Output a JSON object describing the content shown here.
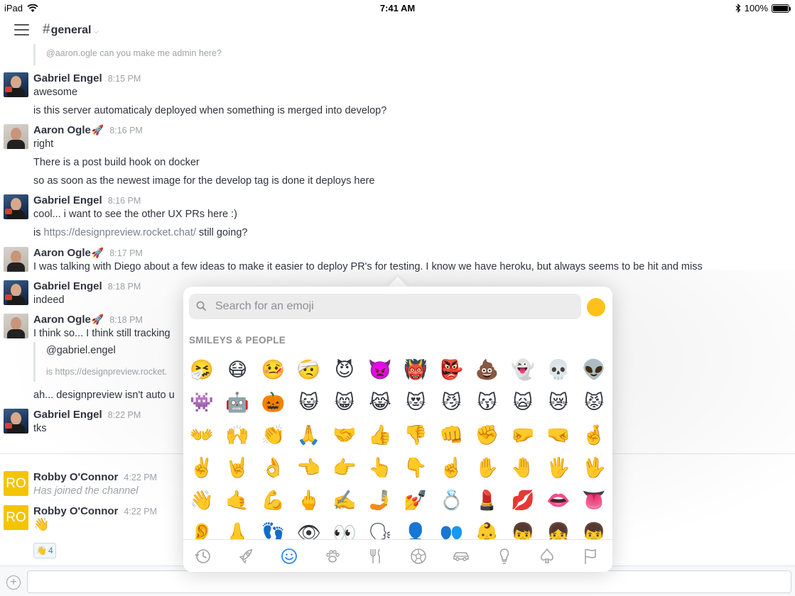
{
  "status_bar": {
    "device": "iPad",
    "time": "7:41 AM",
    "battery": "100%"
  },
  "header": {
    "channel_name": "general"
  },
  "messages": {
    "quote_top": "@aaron.ogle can you make me admin here?",
    "m1": {
      "author": "Gabriel Engel",
      "time": "8:15 PM",
      "lines": [
        "awesome",
        "is this server automaticaly deployed when something is merged into develop?"
      ]
    },
    "m2": {
      "author": "Aaron Ogle",
      "author_emoji": "🚀",
      "time": "8:16 PM",
      "lines": [
        "right",
        "There is a post build hook on docker",
        "so as soon as the newest image for the develop tag is done it deploys here"
      ]
    },
    "m3": {
      "author": "Gabriel Engel",
      "time": "8:16 PM",
      "line1": "cool... i want to see the other UX PRs here :)",
      "line2_prefix": "is ",
      "line2_link": "https://designpreview.rocket.chat/",
      "line2_suffix": " still going?"
    },
    "m4": {
      "author": "Aaron Ogle",
      "author_emoji": "🚀",
      "time": "8:17 PM",
      "line": "I was talking with Diego about a few ideas to make it easier to deploy PR's for testing.  I know we have heroku, but always seems to be hit and miss"
    },
    "m5": {
      "author": "Gabriel Engel",
      "time": "8:18 PM",
      "line": "indeed"
    },
    "m6": {
      "author": "Aaron Ogle",
      "author_emoji": "🚀",
      "time": "8:18 PM",
      "line": "I think so... I think still tracking",
      "quote_user": "@gabriel.engel",
      "quote_text": "is https://designpreview.rocket.",
      "after": "ah... designpreview isn't auto u"
    },
    "m7": {
      "author": "Gabriel Engel",
      "time": "8:22 PM",
      "line": "tks"
    },
    "m8": {
      "author": "Robby O'Connor",
      "initials": "RO",
      "time": "4:22 PM",
      "line": "Has joined the channel"
    },
    "m9": {
      "author": "Robby O'Connor",
      "initials": "RO",
      "time": "4:22 PM",
      "line": "👋",
      "reaction_emoji": "👋",
      "reaction_count": "4"
    }
  },
  "composer": {
    "add_label": "+",
    "placeholder": ""
  },
  "emoji_picker": {
    "search_placeholder": "Search for an emoji",
    "tone_color": "#fcc21b",
    "category": "SMILEYS & PEOPLE",
    "rows": [
      [
        "🤧",
        "😷",
        "🤒",
        "🤕",
        "😈",
        "👿",
        "👹",
        "👺",
        "💩",
        "👻",
        "💀",
        "👽"
      ],
      [
        "👾",
        "🤖",
        "🎃",
        "😺",
        "😸",
        "😹",
        "😻",
        "😼",
        "😽",
        "🙀",
        "😿",
        "😾"
      ],
      [
        "👐",
        "🙌",
        "👏",
        "🙏",
        "🤝",
        "👍",
        "👎",
        "👊",
        "✊",
        "🤛",
        "🤜",
        "🤞"
      ],
      [
        "✌️",
        "🤘",
        "👌",
        "👈",
        "👉",
        "👆",
        "👇",
        "☝️",
        "✋",
        "🤚",
        "🖐",
        "🖖"
      ],
      [
        "👋",
        "🤙",
        "💪",
        "🖕",
        "✍️",
        "🤳",
        "💅",
        "💍",
        "💄",
        "💋",
        "👄",
        "👅"
      ],
      [
        "👂",
        "👃",
        "👣",
        "👁",
        "👀",
        "🗣",
        "👤",
        "👥",
        "👶",
        "👦",
        "👧",
        "👦"
      ]
    ],
    "tabs": [
      "recent-icon",
      "rocket-icon",
      "smiley-icon",
      "paw-icon",
      "fork-knife-icon",
      "ball-icon",
      "car-icon",
      "bulb-icon",
      "spade-icon",
      "flag-icon"
    ],
    "active_tab": "smiley-icon"
  }
}
